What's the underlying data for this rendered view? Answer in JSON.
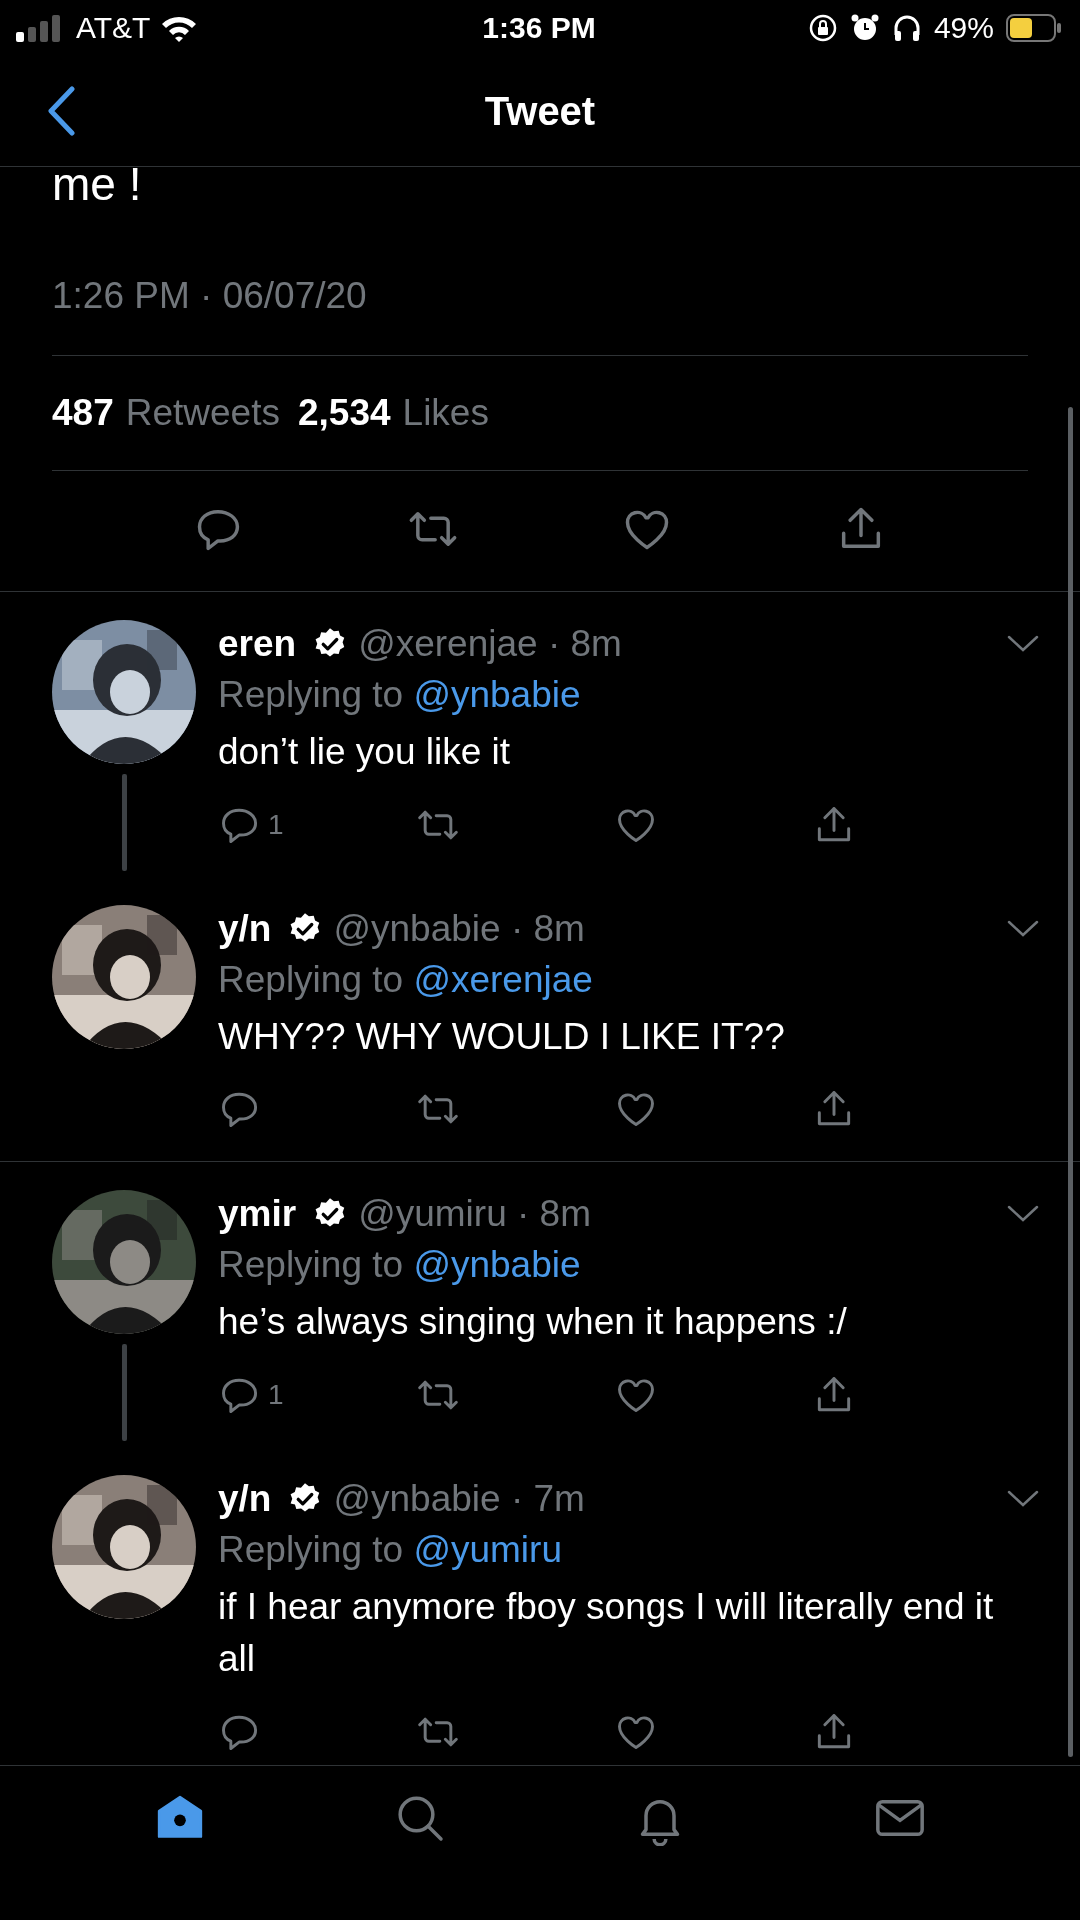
{
  "status_bar": {
    "carrier": "AT&T",
    "time": "1:36 PM",
    "battery": "49%"
  },
  "header": {
    "title": "Tweet"
  },
  "tweet": {
    "text_tail": "me !",
    "timestamp": "1:26 PM · 06/07/20",
    "stats": [
      {
        "count": "487",
        "label": "Retweets"
      },
      {
        "count": "2,534",
        "label": "Likes"
      }
    ]
  },
  "threads": [
    {
      "replies": [
        {
          "name": "eren",
          "verified": true,
          "meta": "@xerenjae · 8m",
          "replying_label": "Replying to",
          "replying_to": "@ynbabie",
          "text": "don’t lie you like it",
          "reply_count": "1"
        },
        {
          "name": "y/n",
          "verified": true,
          "meta": "@ynbabie · 8m",
          "replying_label": "Replying to",
          "replying_to": "@xerenjae",
          "text": "WHY?? WHY WOULD I LIKE IT??"
        }
      ]
    },
    {
      "replies": [
        {
          "name": "ymir",
          "verified": true,
          "meta": "@yumiru · 8m",
          "replying_label": "Replying to",
          "replying_to": "@ynbabie",
          "text": "he’s always singing when it happens :/",
          "reply_count": "1"
        },
        {
          "name": "y/n",
          "verified": true,
          "meta": "@ynbabie · 7m",
          "replying_label": "Replying to",
          "replying_to": "@yumiru",
          "text": "if I hear anymore fboy songs I will literally end it all"
        }
      ]
    }
  ],
  "tab_bar": [
    {
      "kind": "home",
      "selected": true
    },
    {
      "kind": "search",
      "selected": false
    },
    {
      "kind": "notifications",
      "selected": false
    },
    {
      "kind": "messages",
      "selected": false
    }
  ]
}
